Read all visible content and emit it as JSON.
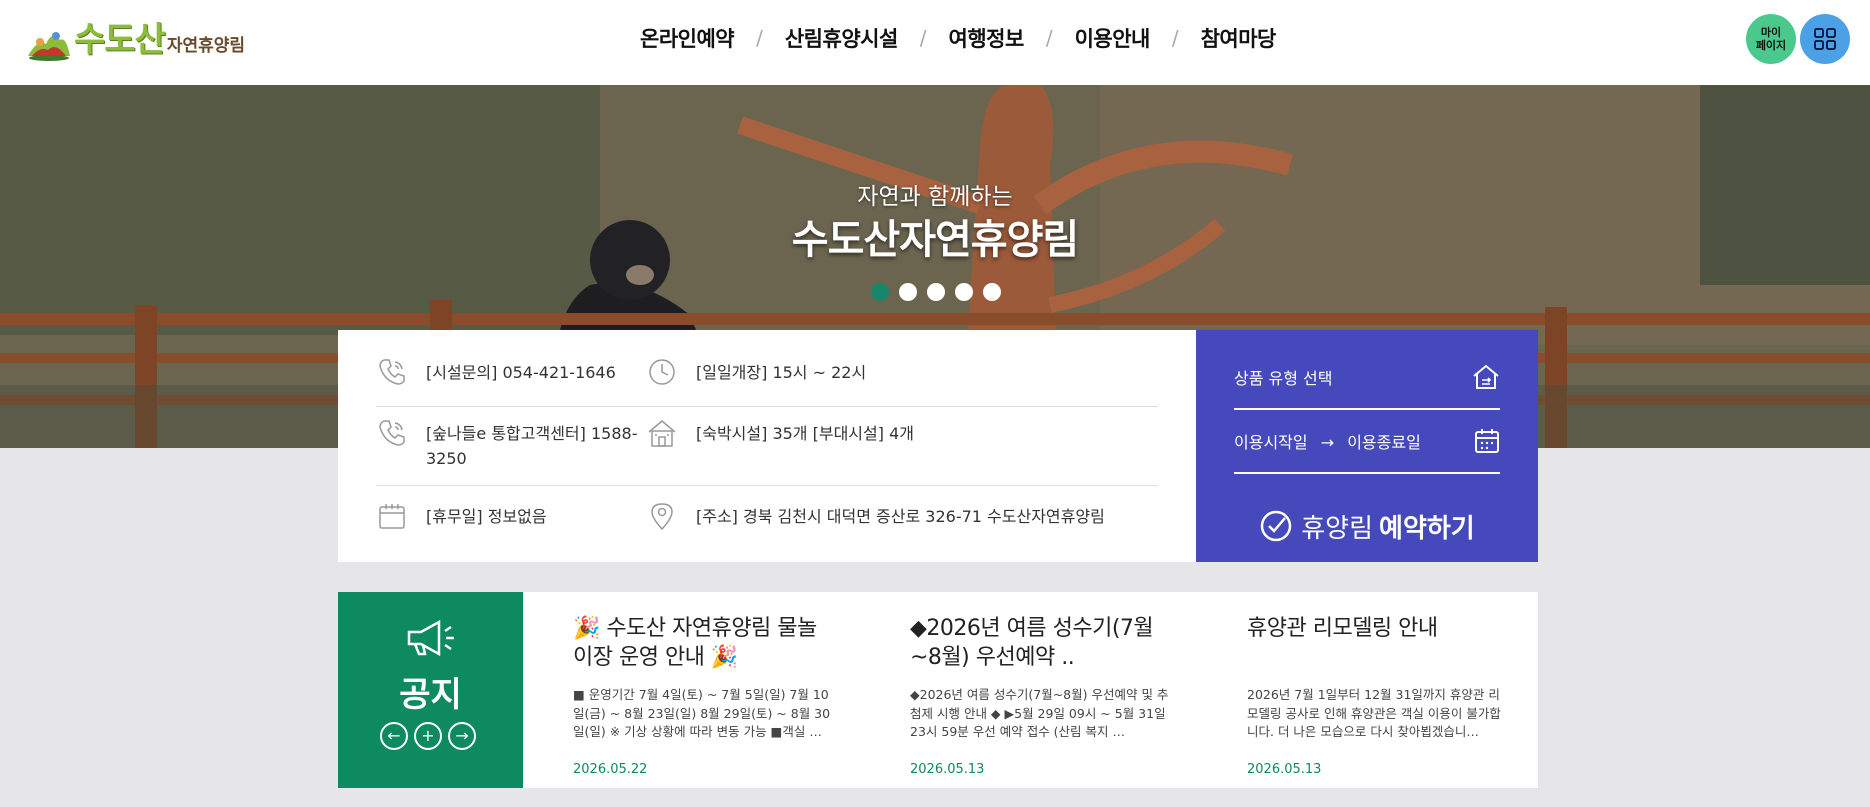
{
  "header": {
    "logo_main": "수도산",
    "logo_sub": "자연휴양림",
    "nav": [
      "온라인예약",
      "산림휴양시설",
      "여행정보",
      "이용안내",
      "참여마당"
    ],
    "nav_separator": "/",
    "mypage_label_1": "마이",
    "mypage_label_2": "페이지"
  },
  "hero": {
    "subtitle": "자연과 함께하는",
    "title": "수도산자연휴양림",
    "slide_count": 5,
    "active_slide": 0
  },
  "info": {
    "phone": "[시설문의] 054-421-1646",
    "hours": "[일일개장] 15시 ~ 22시",
    "callcenter": "[숲나들e 통합고객센터] 1588-3250",
    "facilities": "[숙박시설] 35개 [부대시설] 4개",
    "closed": "[휴무일] 정보없음",
    "address": "[주소] 경북 김천시 대덕면 증산로 326-71 수도산자연휴양림"
  },
  "reservation": {
    "product_select": "상품 유형 선택",
    "start_label": "이용시작일",
    "arrow": "→",
    "end_label": "이용종료일",
    "button_light": "휴양림",
    "button_bold": "예약하기"
  },
  "notice": {
    "label": "공지",
    "controls": [
      "←",
      "+",
      "→"
    ],
    "items": [
      {
        "title": "🎉 수도산 자연휴양림 물놀이장 운영 안내 🎉",
        "body": "■ 운영기간 7월 4일(토) ~ 7월 5일(일) 7월 10일(금) ~ 8월 23일(일) 8월 29일(토) ~ 8월 30일(일) ※ 기상 상황에 따라 변동 가능 ■객실 …",
        "date": "2026.05.22"
      },
      {
        "title": "◆2026년 여름 성수기(7월~8월) 우선예약 ..",
        "body": "◆2026년 여름 성수기(7월~8월) 우선예약 및 추첨제 시행 안내 ◆ ▶5월 29일 09시 ~ 5월 31일 23시 59분 우선 예약 접수 (산림 복지 …",
        "date": "2026.05.13"
      },
      {
        "title": "휴양관 리모델링 안내",
        "body": "2026년 7월 1일부터 12월 31일까지 휴양관 리모델링 공사로 인해 휴양관은 객실 이용이 불가합니다. 더 나은 모습으로 다시 찾아뵙겠습니…",
        "date": "2026.05.13"
      }
    ]
  },
  "colors": {
    "accent_green": "#0d8a5f",
    "reservation_blue": "#4649bb",
    "mypage_green": "#4bc98d",
    "menu_blue": "#4ba0e6"
  }
}
